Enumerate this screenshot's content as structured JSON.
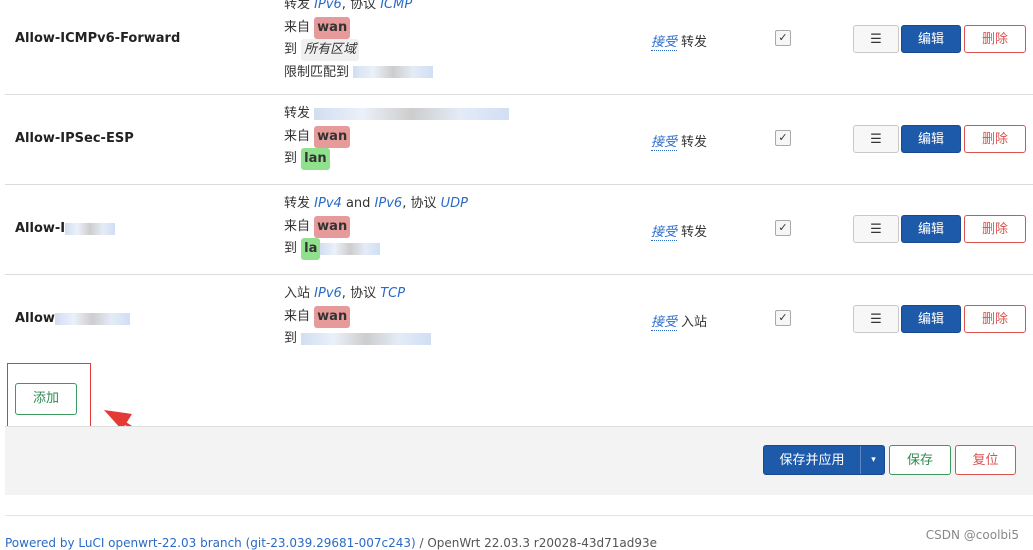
{
  "labels": {
    "forward": "转发",
    "input": "入站",
    "protocol": "协议",
    "from": "来自",
    "to": "到",
    "limit": "限制匹配到",
    "and": "and",
    "accept": "接受",
    "check": "✓",
    "menu": "☰",
    "edit": "编辑",
    "delete": "删除"
  },
  "rules": [
    {
      "name": "Allow-ICMPv6-Forward",
      "family": "IPv6",
      "proto": "ICMP",
      "src": "wan",
      "dest": "所有区域",
      "action": "转发"
    },
    {
      "name": "Allow-IPSec-ESP",
      "src": "wan",
      "dest": "lan",
      "action": "转发"
    },
    {
      "name": "Allow-I",
      "family1": "IPv4",
      "family2": "IPv6",
      "proto": "UDP",
      "src": "wan",
      "dest": "la",
      "action": "转发"
    },
    {
      "name": "Allow",
      "family": "IPv6",
      "proto": "TCP",
      "src": "wan",
      "action": "入站"
    }
  ],
  "add_label": "添加",
  "footer": {
    "save_apply": "保存并应用",
    "caret": "▾",
    "save": "保存",
    "reset": "复位",
    "powered_link": "Powered by LuCI openwrt-22.03 branch (git-23.039.29681-007c243)",
    "version": " / OpenWrt 22.03.3 r20028-43d71ad93e"
  },
  "watermark": "CSDN @coolbi5"
}
